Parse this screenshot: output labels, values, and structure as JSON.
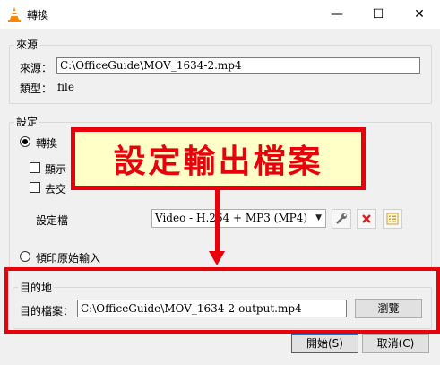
{
  "window": {
    "title": "轉換",
    "minimize_glyph": "—",
    "maximize_glyph": "☐",
    "close_glyph": "✕"
  },
  "source": {
    "group_title": "來源",
    "source_label": "來源：",
    "source_value": "C:\\OfficeGuide\\MOV_1634-2.mp4",
    "type_label": "類型：",
    "type_value": "file"
  },
  "settings": {
    "group_title": "設定",
    "convert_radio_label": "轉換",
    "display_checkbox_label": "顯示",
    "deinterlace_checkbox_label": "去交",
    "profile_label": "設定檔",
    "profile_selected": "Video - H.264 + MP3 (MP4)",
    "dump_radio_label": "傾印原始輸入"
  },
  "destination": {
    "group_title": "目的地",
    "file_label": "目的檔案：",
    "file_value": "C:\\OfficeGuide\\MOV_1634-2-output.mp4",
    "browse_label": "瀏覽"
  },
  "footer": {
    "start_label": "開始(S)",
    "cancel_label": "取消(C)"
  },
  "annotation": {
    "callout_text": "設定輸出檔案"
  },
  "colors": {
    "annotation_red": "#e8000b",
    "callout_fill": "#ffffc8",
    "accent_blue": "#0078d7"
  }
}
